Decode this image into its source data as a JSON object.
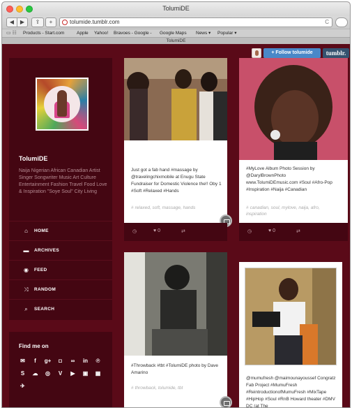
{
  "window": {
    "title": "TolumiDE"
  },
  "toolbar": {
    "url": "tolumide.tumblr.com",
    "reload_glyph": "C",
    "reader_label": "Reader"
  },
  "bookmarks": {
    "items": [
      "Products - Start.com",
      "Apple",
      "Yahoo!",
      "Bravoes - Google -",
      "Google Maps",
      "News ▾",
      "Popular ▾"
    ]
  },
  "tab": {
    "title": "TolumiDE"
  },
  "tumblr_controls": {
    "follow_label": "+ Follow tolumide",
    "logo_text": "tumblr."
  },
  "sidebar": {
    "blog_title": "TolumiDE",
    "description": "Naija Nigerian African Canadian Artist Singer Songwriter Music Art Culture Entertainment Fashion Travel Food Love & Inspiration \"Soye Soul\" City Living",
    "nav": [
      {
        "label": "HOME",
        "icon": "home-icon"
      },
      {
        "label": "ARCHIVES",
        "icon": "archive-icon"
      },
      {
        "label": "FEED",
        "icon": "rss-icon"
      },
      {
        "label": "RANDOM",
        "icon": "shuffle-icon"
      },
      {
        "label": "SEARCH",
        "icon": "search-icon"
      }
    ]
  },
  "findme": {
    "title": "Find me on",
    "icons": [
      "mail-icon",
      "facebook-icon",
      "googleplus-icon",
      "instagram-icon",
      "lastfm-icon",
      "linkedin-icon",
      "pinterest-icon",
      "skype-icon",
      "soundcloud-icon",
      "spotify-icon",
      "vimeo-icon",
      "youtube-icon",
      "video-icon",
      "image-icon",
      "twitter-icon"
    ]
  },
  "posts": [
    {
      "caption": "Just got a fab hand #massage by @travelingchixmobile at Enugu State Fundraiser for Domestic Violence the!! Oby 1 #Soft #Relaxed #Hands",
      "tags": "relaxed, soft, massage, hands",
      "likes": "0"
    },
    {
      "caption": "#MyLove Album Photo Session by @DarylBrownPhoto www.TolumiDEmusic.com #Soul #Afro-Pop #Inspiration #Naija #Canadian",
      "tags": "canadian, soul, mylove, naija, afro, inspiration",
      "likes": "0"
    },
    {
      "caption": "#Throwback #tbt #TolumiDE photo by Dave Amarino",
      "tags": "throwback, tolumide, tbt"
    },
    {
      "caption": "@mumufresh @maimounayoussef Congratz Fab Project #MumuFresh #ReintroductionofMumuFresh #MixTape #HipHop #Soul #RnB Howard theater #DMV DC (at The"
    }
  ],
  "colors": {
    "page_bg": "#5a0a18",
    "panel": "#440612",
    "accent_blue": "#4a88c8"
  }
}
